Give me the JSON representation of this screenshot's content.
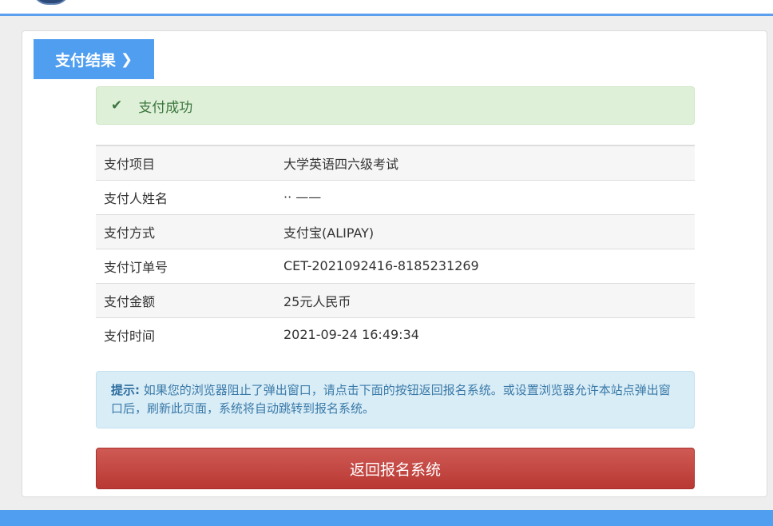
{
  "header": {
    "logo_icon": "emblem-icon"
  },
  "tab": {
    "label": "支付结果",
    "chevron": "❯"
  },
  "success": {
    "icon": "✔",
    "message": "支付成功"
  },
  "details": [
    {
      "key": "支付项目",
      "value": "大学英语四六级考试"
    },
    {
      "key": "支付人姓名",
      "value": "·· ——"
    },
    {
      "key": "支付方式",
      "value": "支付宝(ALIPAY)"
    },
    {
      "key": "支付订单号",
      "value": "CET-2021092416-8185231269"
    },
    {
      "key": "支付金额",
      "value": "25元人民币"
    },
    {
      "key": "支付时间",
      "value": "2021-09-24 16:49:34"
    }
  ],
  "notice": {
    "label": "提示:",
    "text": "如果您的浏览器阻止了弹出窗口，请点击下面的按钮返回报名系统。或设置浏览器允许本站点弹出窗口后，刷新此页面，系统将自动跳转到报名系统。"
  },
  "return_button": {
    "label": "返回报名系统"
  },
  "colors": {
    "primary": "#4f9ef0",
    "success_bg": "#dff0d8",
    "info_bg": "#d9edf7",
    "danger": "#c2403b"
  }
}
